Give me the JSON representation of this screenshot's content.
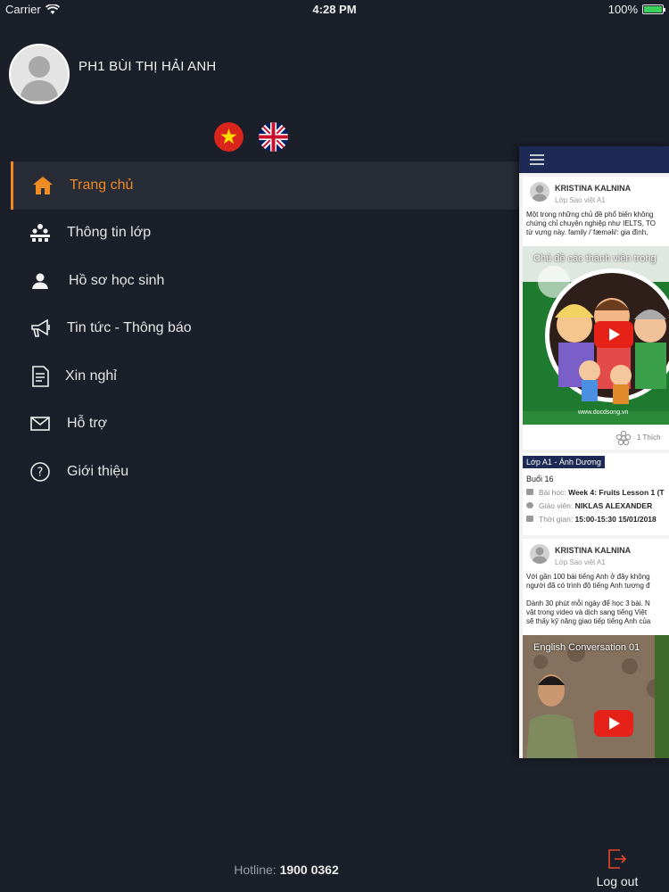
{
  "status_bar": {
    "carrier": "Carrier",
    "time": "4:28 PM",
    "battery": "100%",
    "battery_level": 1.0
  },
  "profile": {
    "name": "PH1 BÙI THỊ HẢI ANH"
  },
  "languages": [
    "vietnamese-flag",
    "uk-flag"
  ],
  "menu": {
    "items": [
      {
        "label": "Trang chủ",
        "icon": "home-icon",
        "active": true
      },
      {
        "label": "Thông tin lớp",
        "icon": "class-info-icon",
        "active": false
      },
      {
        "label": "Hồ sơ học sinh",
        "icon": "student-profile-icon",
        "active": false
      },
      {
        "label": "Tin tức - Thông báo",
        "icon": "megaphone-icon",
        "active": false
      },
      {
        "label": "Xin nghỉ",
        "icon": "leave-request-icon",
        "active": false
      },
      {
        "label": "Hỗ trợ",
        "icon": "envelope-icon",
        "active": false
      },
      {
        "label": "Giới thiệu",
        "icon": "question-icon",
        "active": false
      }
    ]
  },
  "footer": {
    "hotline_label": "Hotline: ",
    "hotline_number": "1900 0362",
    "logout_label": "Log out"
  },
  "preview": {
    "post1": {
      "author": "KRISTINA KALNINA",
      "class": "Lớp Sao việt A1",
      "text": "Một trong những chủ đề phổ biến không\nchứng chỉ chuyên nghiệp như IELTS, TO\ntừ vựng này. family /ˈfæməli/: gia đình,",
      "video_title": "Chủ đề các thành viên trong",
      "watermark": "www.docdsong.vn",
      "likes": "1 Thích"
    },
    "lesson": {
      "class_badge": "Lớp A1 - Ánh Dương",
      "session": "Buổi 16",
      "lesson_label": "Bài học: ",
      "lesson_value": "Week 4: Fruits Lesson 1 (T",
      "teacher_label": "Giáo viên: ",
      "teacher_value": "NIKLAS ALEXANDER",
      "time_label": "Thời gian: ",
      "time_value": "15:00-15:30 15/01/2018"
    },
    "post2": {
      "author": "KRISTINA KALNINA",
      "class": "Lớp Sao việt A1",
      "text": "Với gần 100 bài tiếng Anh ở đây không\nngười đã có trình độ tiếng Anh tương đ\n\nDành 30 phút mỗi ngày để học 3 bài. N\nvật trong video và dịch sang tiếng Việt\nsẽ thấy kỹ năng giao tiếp tiếng Anh của",
      "video_title": "English Conversation 01"
    }
  }
}
